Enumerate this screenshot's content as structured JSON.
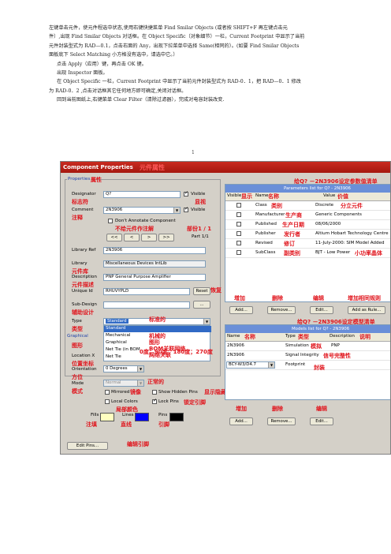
{
  "doc": {
    "lines": [
      "左键单击元件，使元件程选中状态,使用右键快捷菜单 Find Smilar Objects (或者按 SHIFT+F 再左键点击元",
      "件）,出现 Find Smilar Objects 对话框。在 Object Specific（对象细节）一栏，Current Footprint 中显示了当前",
      "元件封装型式为 RAD—0.1，点击右面的 Any，出现下拉菜单中选择 Same(相同的）。(如要 Find Smilar Objects",
      "面板底下 Select Matching 小方格没有选中，请选中它。）",
      "点击 Apply（应用）键，再点击 OK 键。",
      "出现 Inspector 面板。",
      "在 Object Specific 一栏，Current Footprint 中显示了当前元件封装型式为 RAD-0．1，把 RAD—0．1 修改",
      "为 RAD-0．2 ,点击对话框其它任何地方即可确定,关闭对话框。",
      "回到当前图纸上,右键菜单 Clear Filter（清除过滤器），完成对电容封装改变."
    ],
    "signature": "1"
  },
  "dialog": {
    "title": "Component Properties",
    "title_cn": "元件属性",
    "properties_label": "Properties",
    "properties_cn": "属性",
    "designator_label": "Designator",
    "designator_cn": "标志符",
    "designator_value": "Q?",
    "visible_label": "Visible",
    "visible_cn": "显视",
    "comment_label": "Comment",
    "comment_cn": "注释",
    "comment_value": "2N3906",
    "comment_visible_label": "Visible",
    "dont_annotate_label": "Don't Annotate Component",
    "dont_annotate_cn": "不给元件作注解",
    "part_cn": "部份1 / 1",
    "part_label": "Part 1/1",
    "nav_buttons": [
      "<<",
      "<",
      ">",
      ">>"
    ],
    "library_ref_label": "Library Ref",
    "library_ref_value": "2N3906",
    "library_label": "Library",
    "library_cn": "元件库",
    "library_value": "Miscellaneous Devices IntLib",
    "description_label": "Description",
    "description_cn": "元件描述",
    "description_value": "PNP General Purpose Amplifier",
    "unique_id_label": "Unique Id",
    "unique_id_value": "RHUVYPLD",
    "reset_button": "Reset",
    "reset_cn": "恢复",
    "subdesign_label": "Sub-Design",
    "subdesign_cn": "辅助设计",
    "subdesign_button": "...",
    "type_label": "Type",
    "type_cn": "类型",
    "type_value": "Standard",
    "type_value_cn": "标准的",
    "type_options": [
      "Standard",
      "Mechanical",
      "Graphical",
      "Net Tie (in BOM",
      "Net Tie"
    ],
    "type_options_cn": [
      "机械的",
      "图形",
      "BOM关联网络",
      "网络关联"
    ],
    "graphical_label": "Graphical",
    "graphical_cn": "图形",
    "location_label": "Location X",
    "location_cn": "位置坐标",
    "orientation_label": "Orientation",
    "orientation_cn": "方位",
    "orientation_value": "0 Degrees",
    "orientation_cn_values": "0度；90度；180度；270度",
    "mode_label": "Mode",
    "mode_cn": "模式",
    "mode_value": "Normal",
    "mode_value_cn": "正常的",
    "mirrored_label": "Mirrored",
    "mirrored_cn": "镜像",
    "show_hidden_label": "Show Hidden Pins",
    "show_hidden_cn": "显示隐藏的引脚",
    "local_colors_label": "Local Colors",
    "local_colors_cn": "局部颜色",
    "lock_pins_label": "Lock Pins",
    "lock_pins_cn": "锁定引脚",
    "fills_label": "Fills",
    "fills_cn": "注填",
    "lines_label": "Lines",
    "lines_cn": "直线",
    "pins_label": "Pins",
    "pins_cn": "引脚",
    "fills_color": "#ffffc0",
    "lines_color": "#0000ff",
    "pins_color": "#000000",
    "edit_pins_button": "Edit Pins...",
    "edit_pins_cn": "编辑引脚"
  },
  "params": {
    "top_cn": "给Q? －2N3906设定参数值清单",
    "list_title": "Parameters list for Q? - 2N3906",
    "headers": [
      "Visible",
      "Name",
      "Value"
    ],
    "headers_cn": [
      "显示",
      "名称",
      "价值"
    ],
    "rows": [
      {
        "name": "Class",
        "name_cn": "类别",
        "value": "Discrete",
        "value_cn": "分立元件"
      },
      {
        "name": "Manufacturer",
        "name_cn": "生产商",
        "value": "Generic Components",
        "value_cn": ""
      },
      {
        "name": "Published",
        "name_cn": "生产日期",
        "value": "08/06/2000",
        "value_cn": ""
      },
      {
        "name": "Publisher",
        "name_cn": "发行者",
        "value": "Altium Hobart Technology Centre",
        "value_cn": ""
      },
      {
        "name": "Revised",
        "name_cn": "修订",
        "value": "11-July-2000: SIM Model Added",
        "value_cn": ""
      },
      {
        "name": "SubClass",
        "name_cn": "副类别",
        "value": "BJT - Low Power",
        "value_cn": "小功率晶体"
      }
    ],
    "action_cn": [
      "增加",
      "删除",
      "编辑",
      "增加相同规则"
    ],
    "buttons": [
      "Add...",
      "Remove...",
      "Edit...",
      "Add as Rule..."
    ]
  },
  "models": {
    "top_cn": "给Q? －2N3906设定模型清单",
    "list_title": "Models list for Q? - 2N3906",
    "headers": [
      "Name",
      "Type",
      "Description"
    ],
    "headers_cn": [
      "名称",
      "类型",
      "说明"
    ],
    "rows": [
      {
        "name": "2N3906",
        "type": "Simulation",
        "type_cn": "模拟",
        "desc": "PNP"
      },
      {
        "name": "2N3906",
        "type": "Signal Integrity",
        "type_cn": "",
        "desc": "信号完整性"
      },
      {
        "name": "BCY-W3/D4.7",
        "type": "Footprint",
        "type_cn": "",
        "desc": "封装"
      }
    ],
    "action_cn": [
      "增加",
      "删除",
      "编辑"
    ],
    "buttons": [
      "Add...",
      "Remove...",
      "Edit..."
    ]
  }
}
